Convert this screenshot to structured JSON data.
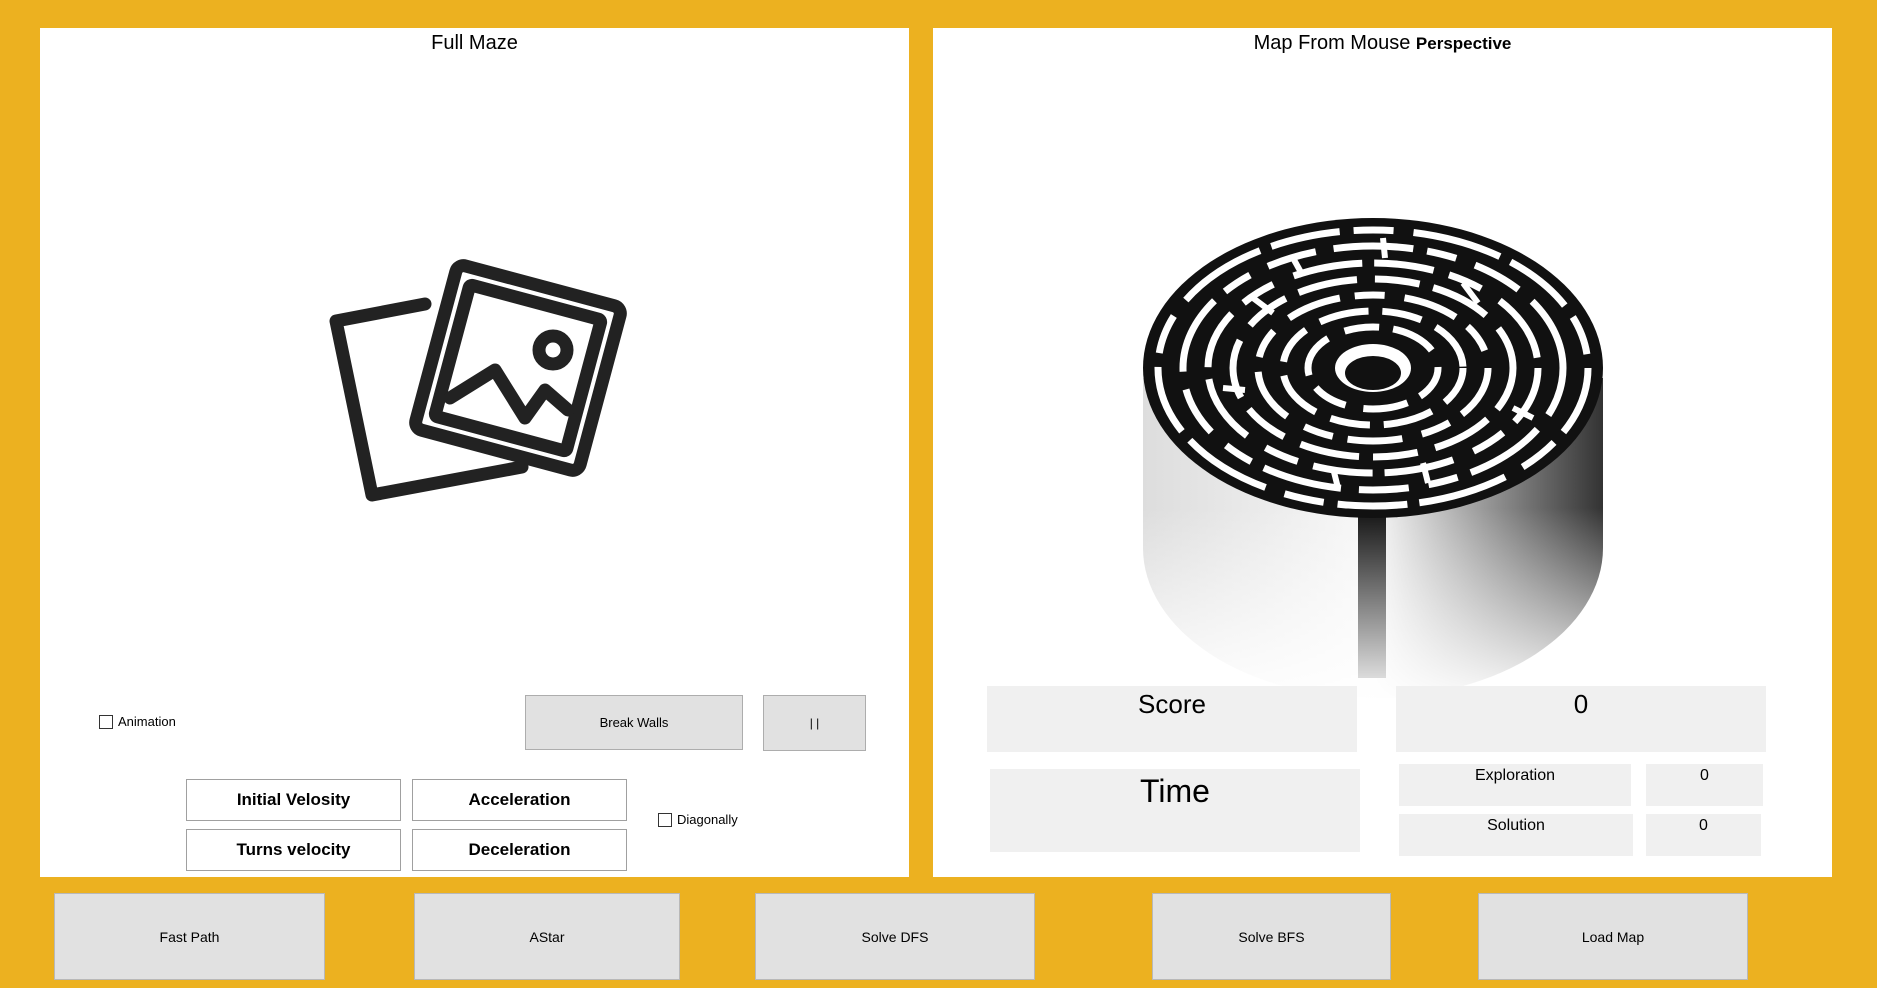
{
  "left": {
    "title": "Full Maze",
    "animation_label": "Animation",
    "break_walls_label": "Break Walls",
    "pause_label": "| |",
    "initial_velocity_placeholder": "Initial Velosity",
    "acceleration_placeholder": "Acceleration",
    "turns_velocity_placeholder": "Turns velocity",
    "deceleration_placeholder": "Deceleration",
    "diagonally_label": "Diagonally"
  },
  "right": {
    "title_main": "Map From Mouse",
    "title_small": "Perspective",
    "score_label": "Score",
    "score_value": "0",
    "time_label": "Time",
    "exploration_label": "Exploration",
    "exploration_value": "0",
    "solution_label": "Solution",
    "solution_value": "0"
  },
  "bottom": {
    "fast_path": "Fast Path",
    "astar": "AStar",
    "solve_dfs": "Solve DFS",
    "solve_bfs": "Solve BFS",
    "load_map": "Load Map"
  },
  "icons": {
    "placeholder": "image-placeholder-icon",
    "maze": "circular-maze-image"
  },
  "colors": {
    "background": "#ECB120",
    "panel": "#FFFFFF",
    "button": "#E1E1E1",
    "stat_box": "#F0F0F0"
  }
}
